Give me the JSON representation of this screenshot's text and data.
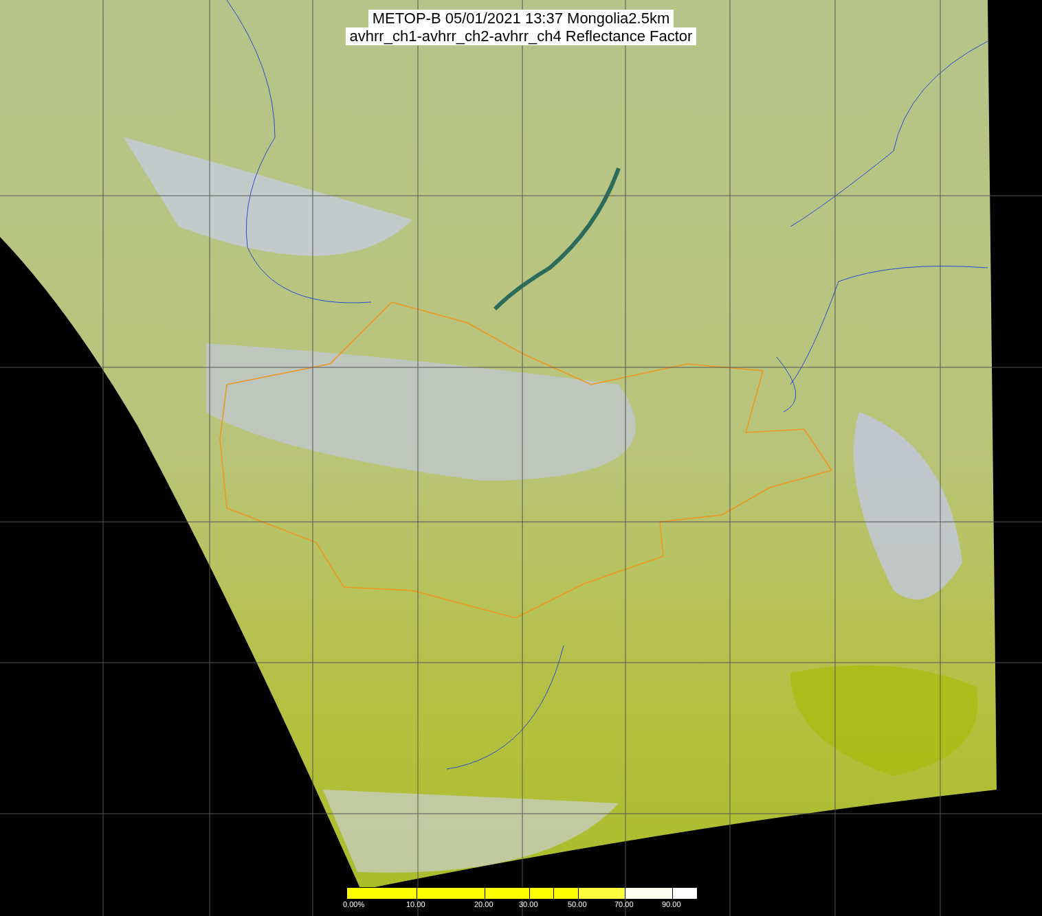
{
  "title": {
    "lines": [
      "METOP-B 05/01/2021 13:37 Mongolia2.5km",
      "avhrr_ch1-avhrr_ch2-avhrr_ch4 Reflectance Factor"
    ]
  },
  "colorbar": {
    "labels": [
      "0.00%",
      "10.00",
      "20.00",
      "30.00",
      "50.00",
      "70.00",
      "90.00"
    ]
  }
}
